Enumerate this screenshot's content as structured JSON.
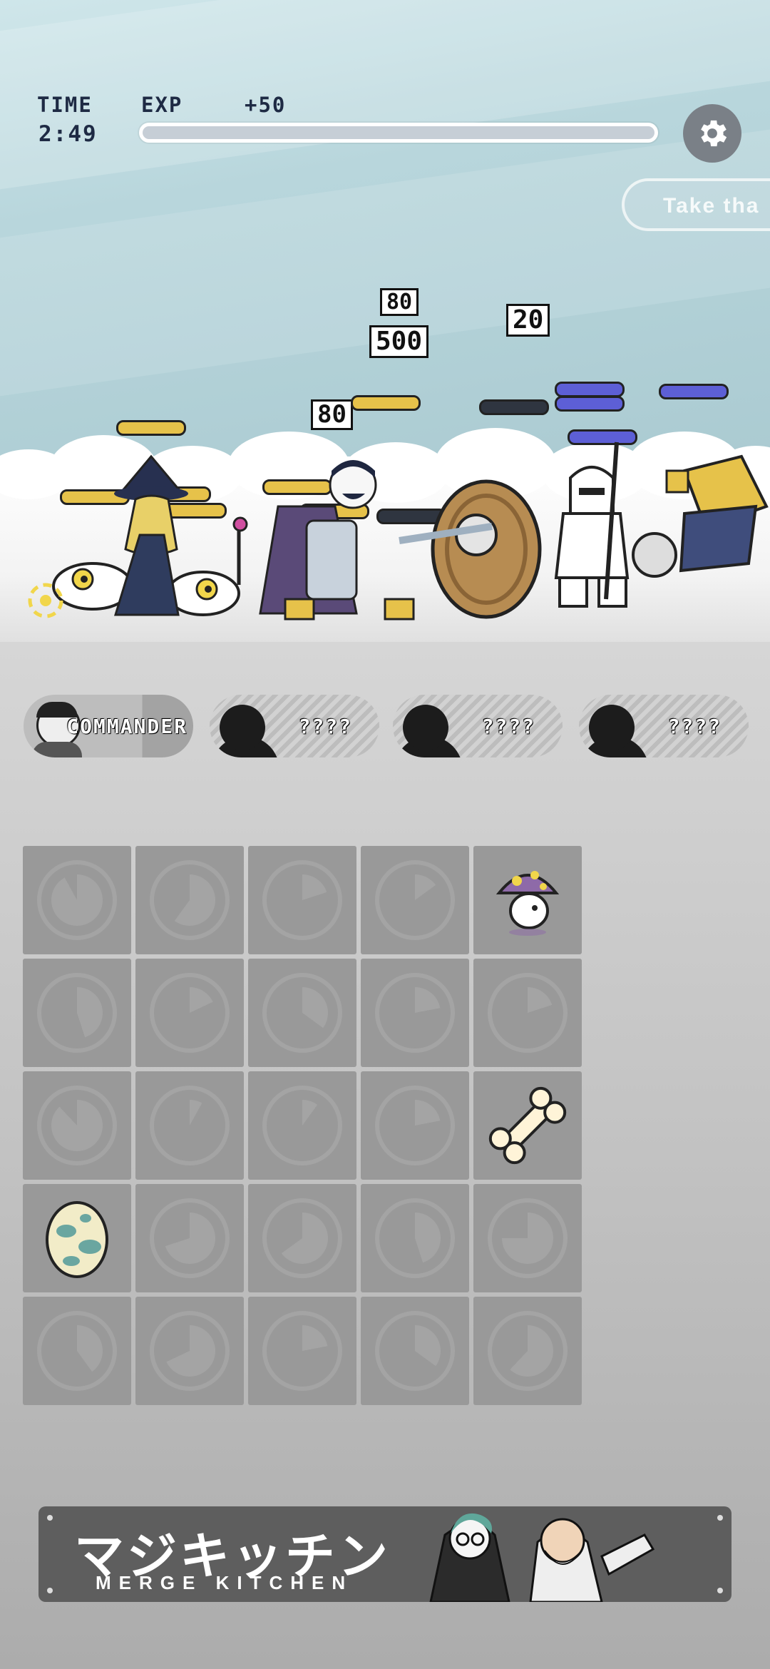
{
  "hud": {
    "time_label": "TIME",
    "time_value": "2:49",
    "exp_label": "EXP",
    "exp_gain": "+50",
    "exp_progress": 0.0,
    "settings_icon": "gear-icon"
  },
  "toast": {
    "text": "Take tha"
  },
  "damage_numbers": [
    "80",
    "500",
    "20",
    "80"
  ],
  "units": [
    {
      "label": "COMMANDER",
      "unlocked": true
    },
    {
      "label": "????",
      "unlocked": false
    },
    {
      "label": "????",
      "unlocked": false
    },
    {
      "label": "????",
      "unlocked": false
    }
  ],
  "grid": {
    "rows": 5,
    "cols": 5,
    "items": [
      {
        "row": 0,
        "col": 4,
        "item": "mushroom-creature"
      },
      {
        "row": 2,
        "col": 4,
        "item": "bone"
      },
      {
        "row": 3,
        "col": 0,
        "item": "spotted-egg"
      }
    ],
    "cooldown_fractions": [
      [
        0.92,
        0.6,
        0.2,
        0.15,
        null
      ],
      [
        0.45,
        0.18,
        0.35,
        0.22,
        0.2
      ],
      [
        0.88,
        0.08,
        0.1,
        0.22,
        null
      ],
      [
        null,
        0.7,
        0.65,
        0.45,
        0.75
      ],
      [
        0.4,
        0.68,
        0.22,
        0.35,
        0.62
      ]
    ]
  },
  "banner": {
    "title_jp": "マジキッチン",
    "title_en": "MERGE KITCHEN"
  },
  "colors": {
    "hp_ally": "#e6c24a",
    "hp_enemy": "#5d5fd6",
    "hud_text": "#1e2a44",
    "cell": "#999999"
  }
}
